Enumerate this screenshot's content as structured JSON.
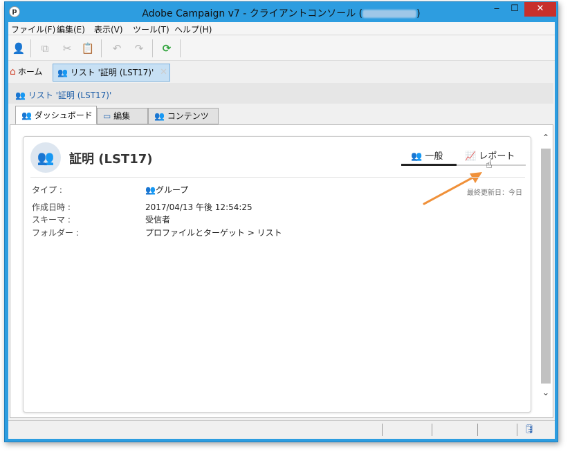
{
  "window": {
    "title_prefix": "Adobe Campaign v7 - クライアントコンソール (",
    "title_suffix": ")",
    "app_icon_glyph": "p",
    "minimize": "‒",
    "maximize": "☐",
    "close": "✕"
  },
  "menu": {
    "items": [
      "ファイル(F)",
      "編集(E)",
      "表示(V)",
      "ツール(T)",
      "ヘルプ(H)"
    ]
  },
  "toolbar": {
    "icons": [
      "new-user-icon",
      "copy-icon",
      "cut-icon",
      "paste-icon",
      "undo-icon",
      "redo-icon",
      "refresh-icon"
    ]
  },
  "doc_tabs": {
    "home": "ホーム",
    "list": "リスト '証明 (LST17)'"
  },
  "breadcrumb": "リスト '証明 (LST17)'",
  "content_tabs": [
    "ダッシュボード",
    "編集",
    "コンテンツ"
  ],
  "card": {
    "title": "証明 (LST17)",
    "views": [
      {
        "label": "一般",
        "active": true
      },
      {
        "label": "レポート",
        "active": false
      }
    ],
    "last_updated": "最終更新日：今日",
    "fields": [
      {
        "label": "タイプ :",
        "value": "グループ"
      },
      {
        "label": "作成日時 :",
        "value": "2017/04/13 午後 12:54:25"
      },
      {
        "label": "スキーマ :",
        "value": "受信者"
      },
      {
        "label": "フォルダー :",
        "value": "プロファイルとターゲット > リスト"
      }
    ]
  },
  "colors": {
    "titlebar": "#2d9de0",
    "close": "#c7302b",
    "arrow": "#f0913a",
    "link": "#1f5fa8"
  }
}
